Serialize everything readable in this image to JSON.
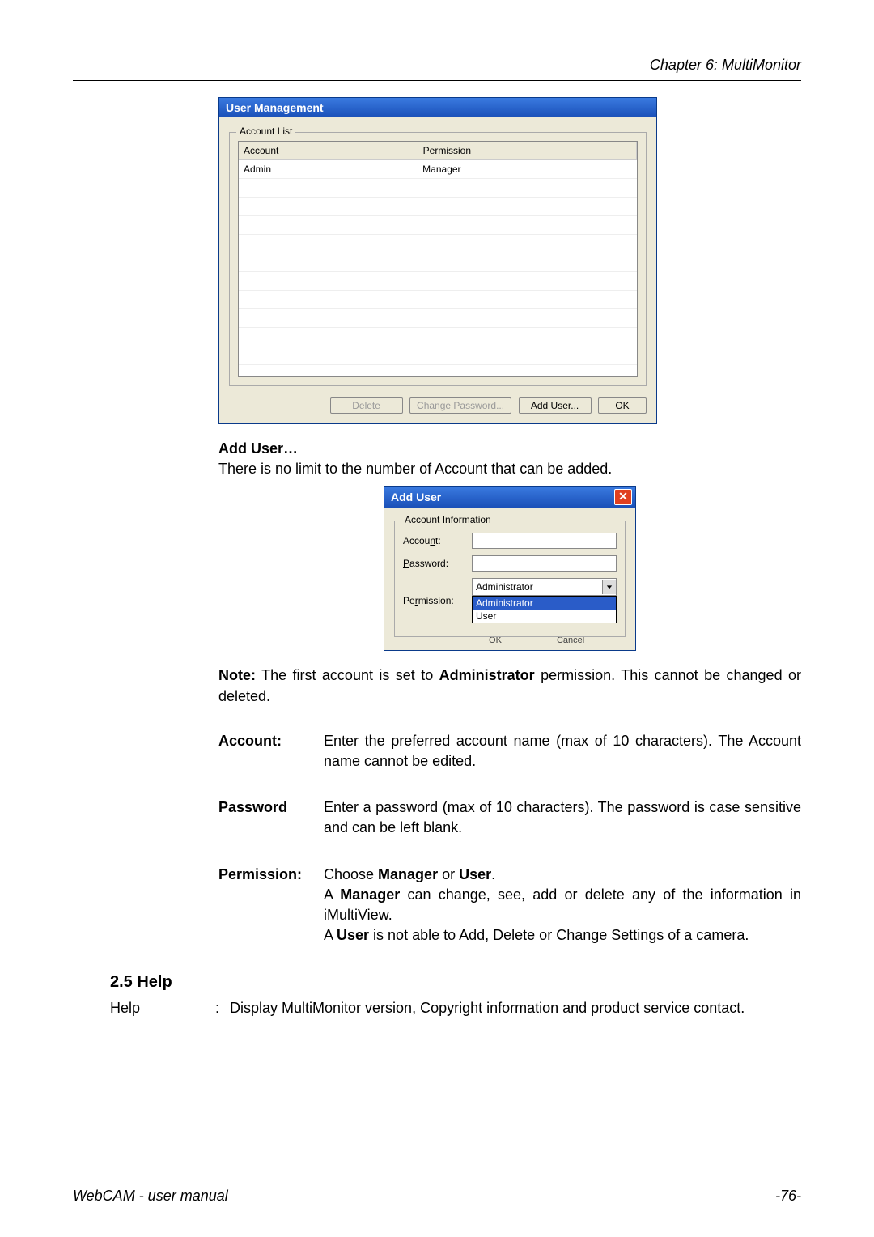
{
  "header": {
    "chapter": "Chapter 6: MultiMonitor"
  },
  "um_window": {
    "title": "User Management",
    "fieldset_label": "Account List",
    "col_account": "Account",
    "col_permission": "Permission",
    "rows": [
      {
        "account": "Admin",
        "permission": "Manager"
      },
      {
        "account": "",
        "permission": ""
      },
      {
        "account": "",
        "permission": ""
      },
      {
        "account": "",
        "permission": ""
      },
      {
        "account": "",
        "permission": ""
      },
      {
        "account": "",
        "permission": ""
      },
      {
        "account": "",
        "permission": ""
      },
      {
        "account": "",
        "permission": ""
      },
      {
        "account": "",
        "permission": ""
      },
      {
        "account": "",
        "permission": ""
      },
      {
        "account": "",
        "permission": ""
      },
      {
        "account": "",
        "permission": ""
      },
      {
        "account": "",
        "permission": ""
      }
    ],
    "btn_delete_pre": "D",
    "btn_delete_ul": "e",
    "btn_delete_post": "lete",
    "btn_chpw_ul": "C",
    "btn_chpw_post": "hange Password...",
    "btn_add_ul": "A",
    "btn_add_post": "dd User...",
    "btn_ok": "OK"
  },
  "text": {
    "add_user_hdr": "Add User…",
    "add_user_desc": "There is no limit to the number of Account that can be added.",
    "note_pre": "Note:",
    "note_mid1": " The first account is set to ",
    "note_bold": "Administrator",
    "note_mid2": " permission.    This cannot be changed or deleted.",
    "t_account": "Account:",
    "d_account": "Enter the preferred account name (max of 10 characters). The Account name cannot be edited.",
    "t_password": "Password",
    "d_password": "Enter a password (max of 10 characters). The password is case sensitive and can be left blank.",
    "t_permission": "Permission:",
    "d_perm_1a": "Choose ",
    "d_perm_1b": "Manager",
    "d_perm_1c": " or ",
    "d_perm_1d": "User",
    "d_perm_1e": ".",
    "d_perm_2a": "A ",
    "d_perm_2b": "Manager",
    "d_perm_2c": " can change, see, add or delete any of the information in iMultiView.",
    "d_perm_3a": "A ",
    "d_perm_3b": "User",
    "d_perm_3c": " is not able to Add, Delete or Change Settings of a camera.",
    "sec_help": "2.5 Help",
    "help_term": "Help",
    "help_colon": ":",
    "help_desc": "Display MultiMonitor version, Copyright information and product service contact."
  },
  "au_window": {
    "title": "Add User",
    "fieldset_label": "Account Information",
    "lbl_account_pre": "Accou",
    "lbl_account_ul": "n",
    "lbl_account_post": "t:",
    "lbl_password_ul": "P",
    "lbl_password_post": "assword:",
    "lbl_permission_pre": "Pe",
    "lbl_permission_ul": "r",
    "lbl_permission_post": "mission:",
    "selected": "Administrator",
    "opt1": "Administrator",
    "opt2": "User",
    "ghost_ok": "OK",
    "ghost_cancel": "Cancel"
  },
  "footer": {
    "left": "WebCAM - user manual",
    "right": "-76-"
  }
}
